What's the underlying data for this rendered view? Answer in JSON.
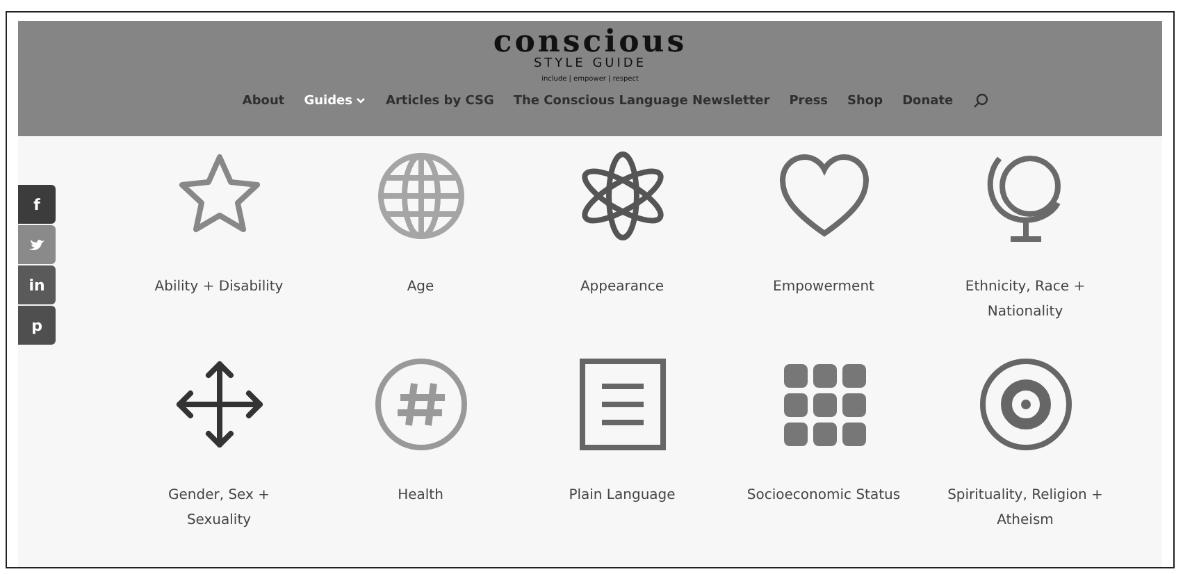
{
  "logo": {
    "title": "conscious",
    "subtitle": "STYLE GUIDE",
    "tagline": "include | empower | respect"
  },
  "nav": [
    {
      "label": "About",
      "selected": false,
      "dropdown": false
    },
    {
      "label": "Guides",
      "selected": true,
      "dropdown": true
    },
    {
      "label": "Articles by CSG",
      "selected": false,
      "dropdown": false
    },
    {
      "label": "The Conscious Language Newsletter",
      "selected": false,
      "dropdown": false
    },
    {
      "label": "Press",
      "selected": false,
      "dropdown": false
    },
    {
      "label": "Shop",
      "selected": false,
      "dropdown": false
    },
    {
      "label": "Donate",
      "selected": false,
      "dropdown": false
    }
  ],
  "share": [
    {
      "kind": "text",
      "label": "f"
    },
    {
      "kind": "bird"
    },
    {
      "kind": "text",
      "label": "in"
    },
    {
      "kind": "text",
      "label": "p"
    }
  ],
  "guides": [
    {
      "label": "Ability + Disability"
    },
    {
      "label": "Age"
    },
    {
      "label": "Appearance"
    },
    {
      "label": "Empowerment"
    },
    {
      "label": "Ethnicity, Race + Nationality"
    },
    {
      "label": "Gender, Sex + Sexuality"
    },
    {
      "label": "Health"
    },
    {
      "label": "Plain Language"
    },
    {
      "label": "Socioeconomic Status"
    },
    {
      "label": "Spirituality, Religion + Atheism"
    }
  ]
}
